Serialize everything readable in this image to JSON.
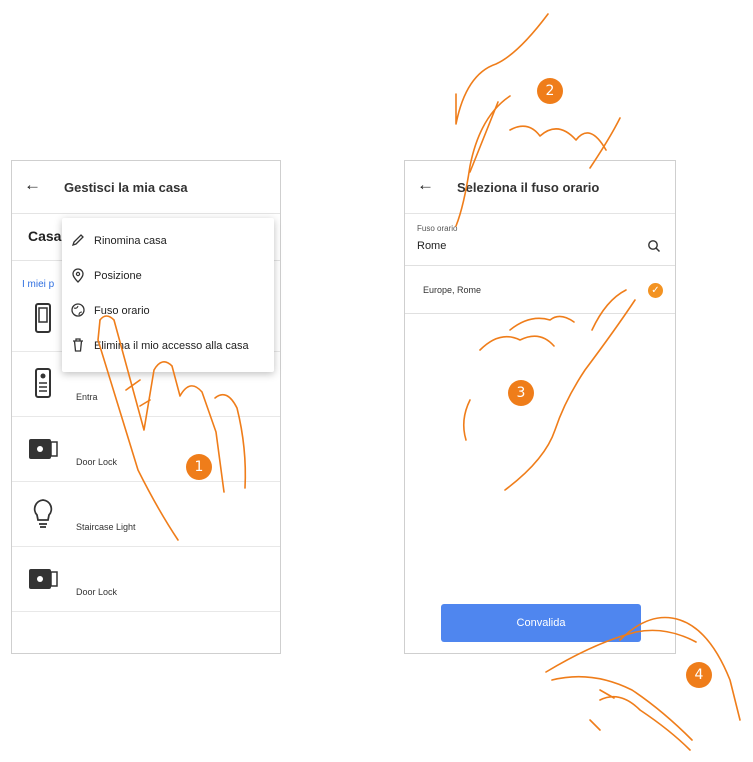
{
  "left_screen": {
    "title": "Gestisci la mia casa",
    "back_icon": "arrow-left",
    "subheader": "Casa",
    "section_link": "I miei p",
    "context_menu": [
      {
        "label": "Rinomina casa",
        "icon": "pencil-icon"
      },
      {
        "label": "Posizione",
        "icon": "location-pin-icon"
      },
      {
        "label": "Fuso orario",
        "icon": "globe-icon"
      },
      {
        "label": "Elimina il mio accesso alla casa",
        "icon": "trash-icon"
      }
    ],
    "devices": [
      {
        "label": "",
        "icon": "door-station-icon"
      },
      {
        "label": "Entra",
        "icon": "intercom-panel-icon"
      },
      {
        "label": "Door Lock",
        "icon": "door-lock-icon"
      },
      {
        "label": "Staircase Light",
        "icon": "lightbulb-icon"
      },
      {
        "label": "Door Lock",
        "icon": "door-lock-icon"
      }
    ]
  },
  "right_screen": {
    "title": "Seleziona il fuso orario",
    "back_icon": "arrow-left",
    "field_label": "Fuso orario",
    "field_value": "Rome",
    "option": "Europe, Rome",
    "confirm_button": "Convalida"
  },
  "steps": [
    "1",
    "2",
    "3",
    "4"
  ],
  "colors": {
    "accent_orange": "#ef7d1a",
    "button_blue": "#4f86ef",
    "link_blue": "#2f6fe0"
  }
}
